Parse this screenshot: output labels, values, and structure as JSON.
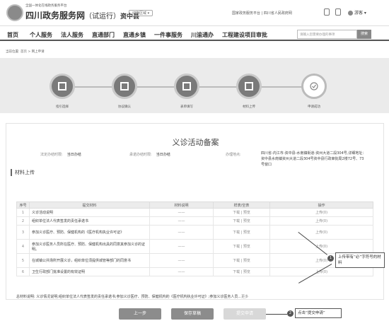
{
  "header": {
    "subtitle": "全国一体化在线政务服务平台",
    "site_name": "四川政务服务网",
    "trial": "（试运行）",
    "county": "资中县",
    "switch_label": "切换区域 ▾",
    "links": "国家政务服务平台 | 四川省人民政府网",
    "user": "游客 ▾"
  },
  "nav": {
    "items": [
      "首页",
      "个人服务",
      "法人服务",
      "直通部门",
      "直通乡镇",
      "一件事服务",
      "川渝通办",
      "工程建设项目审批"
    ],
    "search_placeholder": "请输入您需要办理的事项",
    "search_button": "搜索"
  },
  "breadcrumb": "当前位置:  首页  >  网上申请",
  "steps": [
    {
      "label": "指引选择",
      "icon": "box-icon"
    },
    {
      "label": "协议确认",
      "icon": "document-check-icon"
    },
    {
      "label": "表单填写",
      "icon": "edit-form-icon"
    },
    {
      "label": "材料上传",
      "icon": "upload-icon"
    },
    {
      "label": "申请成功",
      "icon": "check-circle-icon"
    }
  ],
  "service": {
    "title": "义诊活动备案",
    "info": [
      {
        "k": "法定办结时限:",
        "v": "当日办结"
      },
      {
        "k": "承诺办结时限:",
        "v": "当日办结"
      },
      {
        "k": "办理地点:",
        "v": ""
      }
    ],
    "address": "四川省-内江市-资中县-水南镇街道-资州大道二段304号,详细地址：资中县水南镇资州大道二段304号资中县行政审批局2楼72号、73号窗口"
  },
  "materials": {
    "section_title": "材料上传",
    "headers": [
      "序号",
      "提交材料",
      "材料说明",
      "样表/空表",
      "操作"
    ],
    "rows": [
      {
        "no": "1",
        "name": "义诊活动说明",
        "desc": "——",
        "sample": "下载 | 预览",
        "action": "上传(0)"
      },
      {
        "no": "2",
        "name": "组织单位法人代表签发的责任承诺书",
        "desc": "——",
        "sample": "下载 | 预览",
        "action": "上传(0)"
      },
      {
        "no": "3",
        "name": "参加义诊医疗、预防、保健机构的《医疗机构执业许可证》",
        "desc": "——",
        "sample": "下载 | 预览",
        "action": "上传(0)"
      },
      {
        "no": "4",
        "name": "参加义诊医务人员所在医疗、预防、保健机构出具的同意其参加义诊的证明。",
        "desc": "——",
        "sample": "下载 | 预览",
        "action": "上传(0)"
      },
      {
        "no": "5",
        "name": "在城镇公共场所开展义诊，组织单位须提供城管等部门的同意书",
        "desc": "——",
        "sample": "下载 | 预览",
        "action": "上传(0)"
      },
      {
        "no": "6",
        "name": "卫生行政部门批准设置的有效证明",
        "desc": "——",
        "sample": "下载 | 预览",
        "action": "上传(0)"
      }
    ],
    "summary": "总材料说明:  义诊情况说明;组织单位法人代表签发的责任承诺书;参加义诊医疗、预防、保健机构的《医疗机构执业许可证》;参加义诊医务人员...",
    "more": "更多"
  },
  "buttons": {
    "prev": "上一步",
    "save": "保存草稿",
    "submit": "提交申请"
  },
  "annotations": [
    {
      "n": "1",
      "text": "上传带有“必”字符号的材料"
    },
    {
      "n": "2",
      "text": "点击“提交申请”"
    }
  ]
}
